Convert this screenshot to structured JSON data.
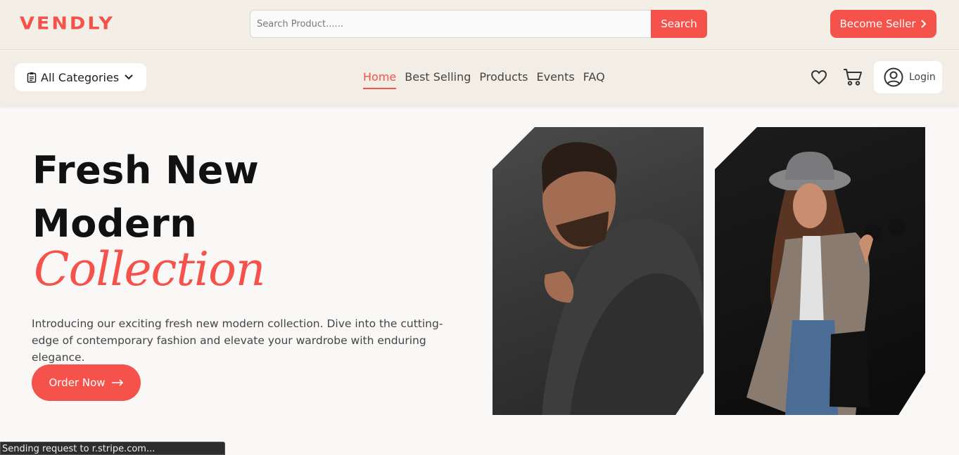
{
  "header": {
    "logo": "VENDLY",
    "search": {
      "placeholder": "Search Product......",
      "value": "",
      "button_label": "Search"
    },
    "become_seller_label": "Become Seller"
  },
  "navbar": {
    "categories_label": "All Categories",
    "links": [
      {
        "label": "Home",
        "active": true
      },
      {
        "label": "Best Selling",
        "active": false
      },
      {
        "label": "Products",
        "active": false
      },
      {
        "label": "Events",
        "active": false
      },
      {
        "label": "FAQ",
        "active": false
      }
    ],
    "login_label": "Login"
  },
  "hero": {
    "title_line1": "Fresh New",
    "title_line2": "Modern",
    "title_script": "Collection",
    "description": "Introducing our exciting fresh new modern collection. Dive into the cutting-edge of contemporary fashion and elevate your wardrobe with enduring elegance.",
    "cta_label": "Order Now"
  },
  "status_bar": {
    "text": "Sending request to r.stripe.com..."
  },
  "colors": {
    "accent": "#f4524b",
    "header_bg": "#f3efe7",
    "page_bg": "#f9f8f6"
  },
  "icons": [
    "clipboard-icon",
    "chevron-down-icon",
    "heart-icon",
    "cart-icon",
    "user-circle-icon",
    "chevron-right-icon",
    "arrow-right-icon"
  ]
}
